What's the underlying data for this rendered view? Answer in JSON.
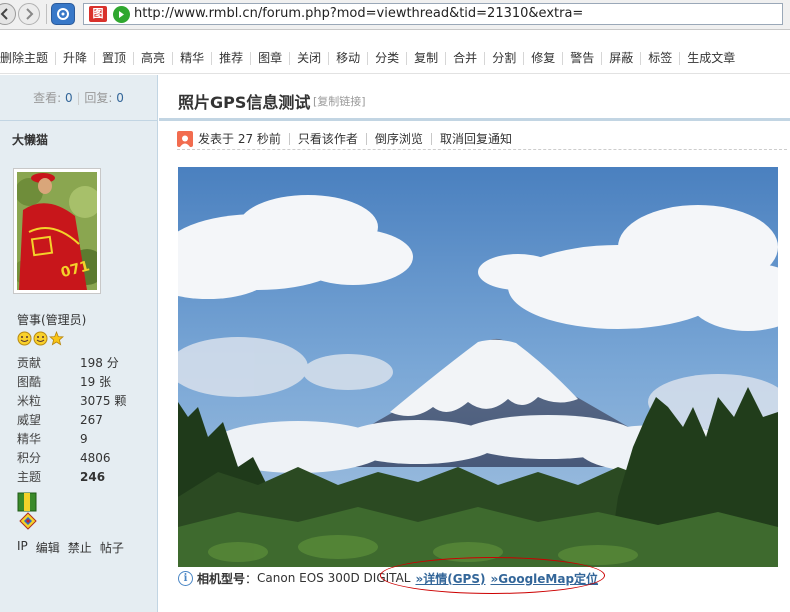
{
  "browser": {
    "url": "http://www.rmbl.cn/forum.php?mod=viewthread&tid=21310&extra=",
    "site_icon_glyph": "图"
  },
  "mod_toolbar": {
    "items": [
      "删除主题",
      "升降",
      "置顶",
      "高亮",
      "精华",
      "推荐",
      "图章",
      "关闭",
      "移动",
      "分类",
      "复制",
      "合并",
      "分割",
      "修复",
      "警告",
      "屏蔽",
      "标签",
      "生成文章"
    ]
  },
  "sidebar": {
    "views_label": "查看:",
    "views": "0",
    "replies_label": "回复:",
    "replies": "0",
    "author": "大懒猫",
    "role": "管事(管理员)",
    "stats": [
      {
        "label": "贡献",
        "value": "198 分"
      },
      {
        "label": "图酷",
        "value": "19 张"
      },
      {
        "label": "米粒",
        "value": "3075 颗"
      },
      {
        "label": "威望",
        "value": "267"
      },
      {
        "label": "精华",
        "value": "9"
      },
      {
        "label": "积分",
        "value": "4806"
      },
      {
        "label": "主题",
        "value": "246"
      }
    ],
    "links": [
      "IP",
      "编辑",
      "禁止",
      "帖子"
    ]
  },
  "post": {
    "title": "照片GPS信息测试",
    "copy_link": "[复制链接]",
    "posted": "发表于 27 秒前",
    "only_author": "只看该作者",
    "reverse": "倒序浏览",
    "cancel_notify": "取消回复通知"
  },
  "exif": {
    "label": "相机型号",
    "sep": "：",
    "camera": "Canon EOS 300D DIGITAL",
    "details_link": "»详情(GPS)",
    "map_link": "»GoogleMap定位"
  },
  "colors": {
    "sidebar_bg": "#e5edf2",
    "link": "#336699",
    "accent_red": "#cc0000"
  }
}
